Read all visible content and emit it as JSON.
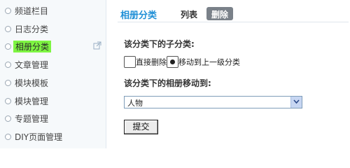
{
  "sidebar": {
    "items": [
      {
        "label": "频道栏目",
        "active": false
      },
      {
        "label": "日志分类",
        "active": false
      },
      {
        "label": "相册分类",
        "active": true
      },
      {
        "label": "文章管理",
        "active": false
      },
      {
        "label": "模块模板",
        "active": false
      },
      {
        "label": "模块管理",
        "active": false
      },
      {
        "label": "专题管理",
        "active": false
      },
      {
        "label": "DIY页面管理",
        "active": false
      }
    ],
    "highlight_color": "#7ef542",
    "external_link_icon": "external-link-icon"
  },
  "header": {
    "title": "相册分类",
    "tabs": [
      {
        "label": "列表"
      },
      {
        "label": "删除"
      }
    ]
  },
  "form": {
    "subcategory_heading": "该分类下的子分类:",
    "options": [
      {
        "label": "直接删除",
        "checked": false
      },
      {
        "label": "移动到上一级分类",
        "checked": true
      }
    ],
    "move_heading": "该分类下的相册移动到:",
    "target_select_value": "人物",
    "submit_label": "提交"
  },
  "colors": {
    "title": "#1f8fd6",
    "active_tab_bg": "#7a8189"
  }
}
